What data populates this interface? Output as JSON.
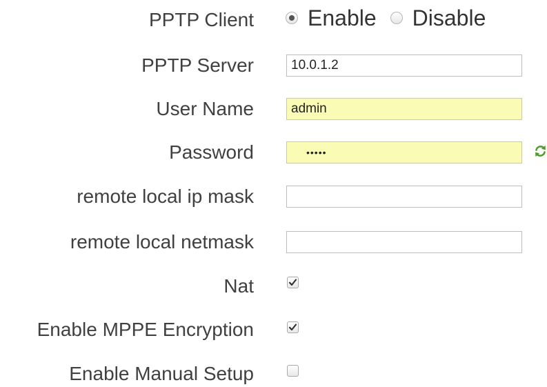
{
  "form": {
    "pptp_client": {
      "label": "PPTP Client",
      "options": [
        {
          "label": "Enable",
          "selected": true
        },
        {
          "label": "Disable",
          "selected": false
        }
      ]
    },
    "pptp_server": {
      "label": "PPTP Server",
      "value": "10.0.1.2"
    },
    "user_name": {
      "label": "User Name",
      "value": "admin"
    },
    "password": {
      "label": "Password",
      "value": "•••••",
      "icon": "refresh-icon"
    },
    "remote_local_ip_mask": {
      "label": "remote local ip mask",
      "value": ""
    },
    "remote_local_netmask": {
      "label": "remote local netmask",
      "value": ""
    },
    "nat": {
      "label": "Nat",
      "checked": true
    },
    "mppe_encryption": {
      "label": "Enable MPPE Encryption",
      "checked": true
    },
    "manual_setup": {
      "label": "Enable Manual Setup",
      "checked": false
    }
  },
  "colors": {
    "label_text": "#404040",
    "autofill_background": "#fafcb6",
    "input_border": "#bdbdbd",
    "refresh_icon": "#4c9a2a"
  }
}
